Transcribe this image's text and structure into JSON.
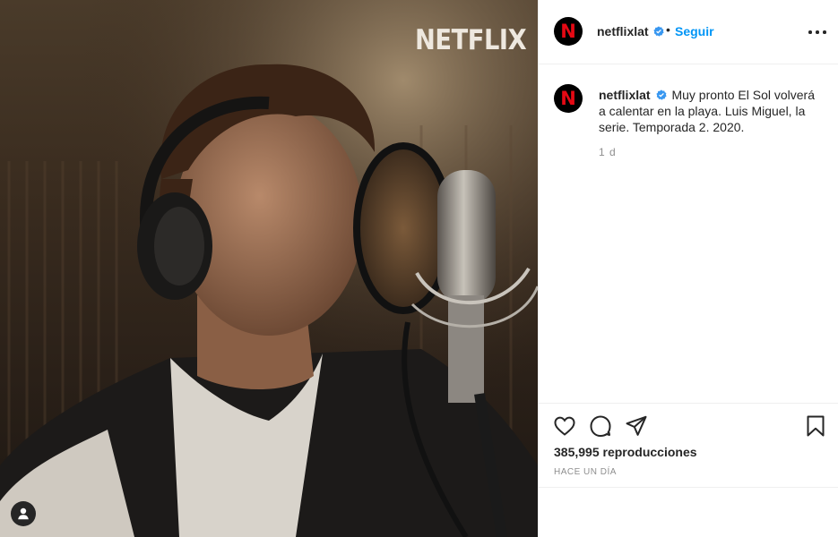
{
  "media": {
    "watermark": "NETFLIX",
    "audio_icon": "user-icon"
  },
  "post": {
    "username": "netflixlat",
    "verified_icon": "verified-badge-icon",
    "separator": "•",
    "follow_label": "Seguir",
    "more_icon": "more-options-icon",
    "avatar_letter": "N"
  },
  "caption": {
    "username": "netflixlat",
    "text": "Muy pronto El Sol volverá a calentar en la playa. Luis Miguel, la serie. Temporada 2. 2020.",
    "time": "1 d"
  },
  "actions": {
    "like_icon": "heart-icon",
    "comment_icon": "comment-icon",
    "share_icon": "share-icon",
    "save_icon": "bookmark-icon",
    "views": "385,995 reproducciones",
    "timestamp": "HACE UN DÍA"
  },
  "colors": {
    "follow": "#0095f6",
    "verified": "#3897f0",
    "netflix_red": "#e50914",
    "muted": "#8e8e8e"
  }
}
